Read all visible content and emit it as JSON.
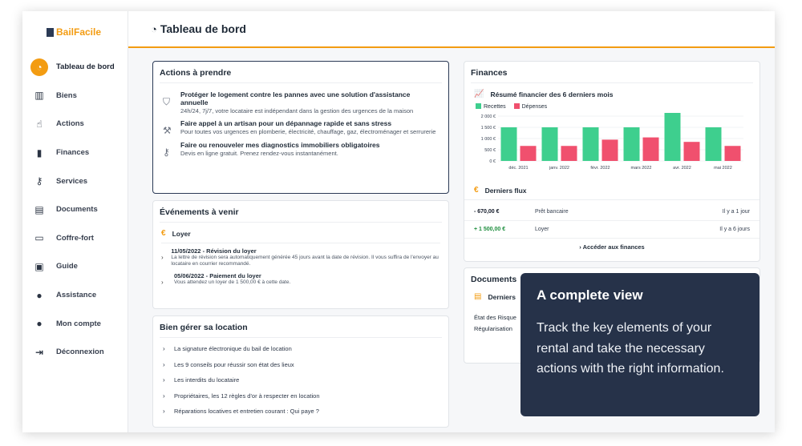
{
  "app": {
    "logo": "BailFacile"
  },
  "header": {
    "title": "Tableau de bord",
    "icon": "gauge-icon"
  },
  "sidebar": {
    "items": [
      {
        "label": "Tableau de bord",
        "icon": "gauge-icon",
        "active": true
      },
      {
        "label": "Biens",
        "icon": "building-icon"
      },
      {
        "label": "Actions",
        "icon": "hand-pointer-icon"
      },
      {
        "label": "Finances",
        "icon": "bar-chart-icon"
      },
      {
        "label": "Services",
        "icon": "key-icon"
      },
      {
        "label": "Documents",
        "icon": "document-icon"
      },
      {
        "label": "Coffre-fort",
        "icon": "archive-icon"
      },
      {
        "label": "Guide",
        "icon": "book-icon"
      },
      {
        "label": "Assistance",
        "icon": "chat-icon"
      },
      {
        "label": "Mon compte",
        "icon": "user-icon"
      },
      {
        "label": "Déconnexion",
        "icon": "logout-icon"
      }
    ]
  },
  "actions": {
    "title": "Actions à prendre",
    "items": [
      {
        "icon": "shield-icon",
        "title": "Protéger le logement contre les pannes avec une solution d'assistance annuelle",
        "desc": "24h/24, 7j/7, votre locataire est indépendant dans la gestion des urgences de la maison"
      },
      {
        "icon": "wrench-icon",
        "title": "Faire appel à un artisan pour un dépannage rapide et sans stress",
        "desc": "Pour toutes vos urgences en plomberie, électricité, chauffage, gaz, électroménager et serrurerie"
      },
      {
        "icon": "key-icon",
        "title": "Faire ou renouveler mes diagnostics immobiliers obligatoires",
        "desc": "Devis en ligne gratuit. Prenez rendez-vous instantanément."
      }
    ]
  },
  "events": {
    "title": "Événements à venir",
    "category": "Loyer",
    "items": [
      {
        "title": "11/05/2022 - Révision du loyer",
        "desc": "La lettre de révision sera automatiquement générée 45 jours avant la date de révision. Il vous suffira de l'envoyer au locataire en courrier recommandé."
      },
      {
        "title": "05/06/2022 - Paiement du loyer",
        "desc": "Vous attendez un loyer de 1 500,00 € à cette date."
      }
    ]
  },
  "guide": {
    "title": "Bien gérer sa location",
    "items": [
      "La signature électronique du bail de location",
      "Les 9 conseils pour réussir son état des lieux",
      "Les interdits du locataire",
      "Propriétaires, les 12 règles d'or à respecter en location",
      "Réparations locatives et entretien courant : Qui paye ?"
    ]
  },
  "finances": {
    "title": "Finances",
    "subtitle": "Résumé financier des 6 derniers mois",
    "flux_title": "Derniers flux",
    "flux": [
      {
        "amount": "- 670,00 €",
        "label": "Prêt bancaire",
        "when": "Il y a 1 jour",
        "color": "#111827"
      },
      {
        "amount": "+ 1 500,00 €",
        "label": "Loyer",
        "when": "Il y a 6 jours",
        "color": "#1e8e3e"
      }
    ],
    "link": "Accéder aux finances"
  },
  "documents": {
    "title": "Documents",
    "sub": "Derniers",
    "rows": [
      "État des Risque",
      "Régularisation"
    ]
  },
  "tooltip": {
    "title": "A complete view",
    "body": "Track the key elements of your rental and take the necessary actions with the right information."
  },
  "colors": {
    "accent": "#f39c12",
    "recettes": "#3ecf8e",
    "depenses": "#f0506e",
    "tooltip_bg": "#263249"
  },
  "chart_data": {
    "type": "bar",
    "title": "Résumé financier des 6 derniers mois",
    "categories": [
      "déc. 2021",
      "janv. 2022",
      "févr. 2022",
      "mars 2022",
      "avr. 2022",
      "mai 2022"
    ],
    "series": [
      {
        "name": "Recettes",
        "values": [
          1500,
          1500,
          1500,
          1500,
          2300,
          1500
        ]
      },
      {
        "name": "Dépenses",
        "values": [
          670,
          670,
          950,
          1050,
          850,
          670
        ]
      }
    ],
    "y_ticks": [
      "2 000 €",
      "1 500 €",
      "1 000 €",
      "500 €",
      "0 €"
    ],
    "ylim": [
      0,
      2000
    ],
    "grid": true,
    "legend": "top-left"
  }
}
